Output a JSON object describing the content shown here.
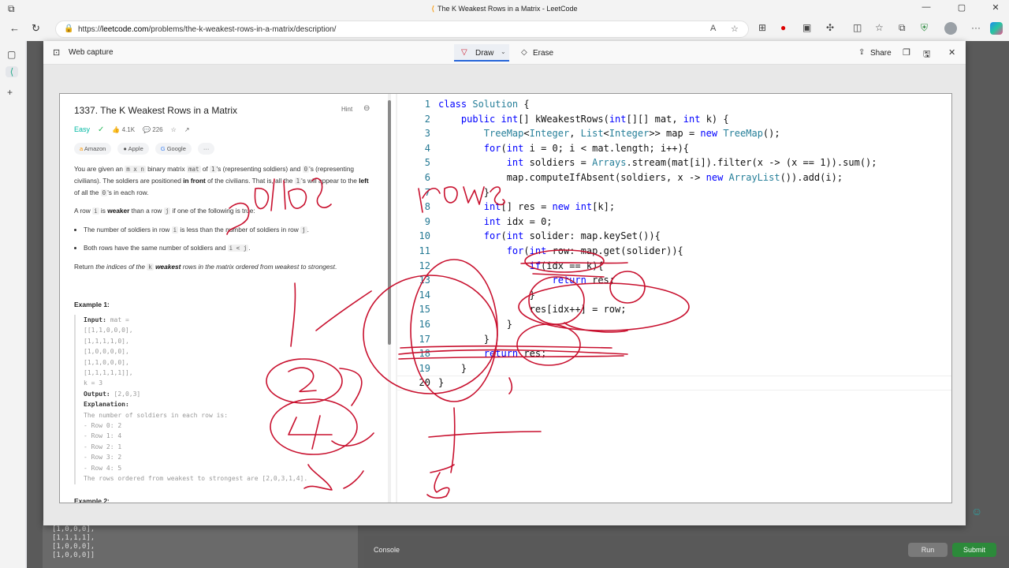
{
  "browser": {
    "title": "The K Weakest Rows in a Matrix - LeetCode",
    "url_host": "leetcode.com",
    "url_prefix": "https://",
    "url_path": "/problems/the-k-weakest-rows-in-a-matrix/description/"
  },
  "capture": {
    "title": "Web capture",
    "draw_label": "Draw",
    "erase_label": "Erase",
    "share_label": "Share"
  },
  "problem": {
    "title": "1337. The K Weakest Rows in a Matrix",
    "hint": "Hint",
    "difficulty": "Easy",
    "likes": "4.1K",
    "dislikes": "226",
    "tags": [
      "Amazon",
      "Apple",
      "Google"
    ],
    "tags_more": "···",
    "p1_a": "You are given an ",
    "p1_mxn": "m x n",
    "p1_b": " binary matrix ",
    "p1_mat": "mat",
    "p1_c": " of ",
    "p1_one": "1",
    "p1_d": "'s (representing soldiers) and ",
    "p1_zero": "0",
    "p1_e": "'s (representing civilians). The soldiers are positioned ",
    "p1_front": "in front",
    "p1_f": " of the civilians. That is, all the ",
    "p1_one2": "1",
    "p1_g": "'s will appear to the ",
    "p1_left": "left",
    "p1_h": " of all the ",
    "p1_zero2": "0",
    "p1_i": "'s in each row.",
    "p2_a": "A row ",
    "p2_i": "i",
    "p2_b": " is ",
    "p2_weaker": "weaker",
    "p2_c": " than a row ",
    "p2_j": "j",
    "p2_d": " if one of the following is true:",
    "b1_a": "The number of soldiers in row ",
    "b1_i": "i",
    "b1_b": " is less than the number of soldiers in row ",
    "b1_j": "j",
    "b1_c": ".",
    "b2_a": "Both rows have the same number of soldiers and ",
    "b2_code": "i < j",
    "b2_b": ".",
    "p3_a": "Return ",
    "p3_b": "the indices of the ",
    "p3_k": "k",
    "p3_c": " ",
    "p3_weakest": "weakest",
    "p3_d": " rows in the matrix ordered from weakest to strongest",
    "p3_e": ".",
    "example1_title": "Example 1:",
    "example2_title": "Example 2:",
    "ex1_input_label": "Input:",
    "ex1_input_head": " mat =",
    "ex1_rows": [
      "[[1,1,0,0,0],",
      " [1,1,1,1,0],",
      " [1,0,0,0,0],",
      " [1,1,0,0,0],",
      " [1,1,1,1,1]],"
    ],
    "ex1_k": "k = 3",
    "ex1_output_label": "Output:",
    "ex1_output": " [2,0,3]",
    "ex1_expl_label": "Explanation:",
    "ex1_expl": [
      "The number of soldiers in each row is:",
      "- Row 0: 2",
      "- Row 1: 4",
      "- Row 2: 1",
      "- Row 3: 2",
      "- Row 4: 5",
      "The rows ordered from weakest to strongest are [2,0,3,1,4]."
    ]
  },
  "code": {
    "line_numbers": [
      "1",
      "2",
      "3",
      "4",
      "5",
      "6",
      "7",
      "8",
      "9",
      "10",
      "11",
      "12",
      "13",
      "14",
      "15",
      "16",
      "17",
      "18",
      "19",
      "20"
    ],
    "lines": [
      "class Solution {",
      "    public int[] kWeakestRows(int[][] mat, int k) {",
      "        TreeMap<Integer, List<Integer>> map = new TreeMap();",
      "        for(int i = 0; i < mat.length; i++){",
      "            int soldiers = Arrays.stream(mat[i]).filter(x -> (x == 1)).sum();",
      "            map.computeIfAbsent(soldiers, x -> new ArrayList()).add(i);",
      "        }",
      "        int[] res = new int[k];",
      "        int idx = 0;",
      "        for(int solider: map.keySet()){",
      "            for(int row: map.get(solider)){",
      "                if(idx == k){",
      "                    return res;",
      "                }",
      "                res[idx++] = row;",
      "            }",
      "        }",
      "        return res;",
      "    }",
      "}"
    ]
  },
  "background": {
    "rows": [
      "[1,0,0,0],",
      "[1,1,1,1],",
      "[1,0,0,0],",
      "[1,0,0,0]]"
    ],
    "console": "Console",
    "run": "Run",
    "submit": "Submit"
  },
  "colors": {
    "ink": "#c8102e",
    "accent": "#2765d9"
  }
}
